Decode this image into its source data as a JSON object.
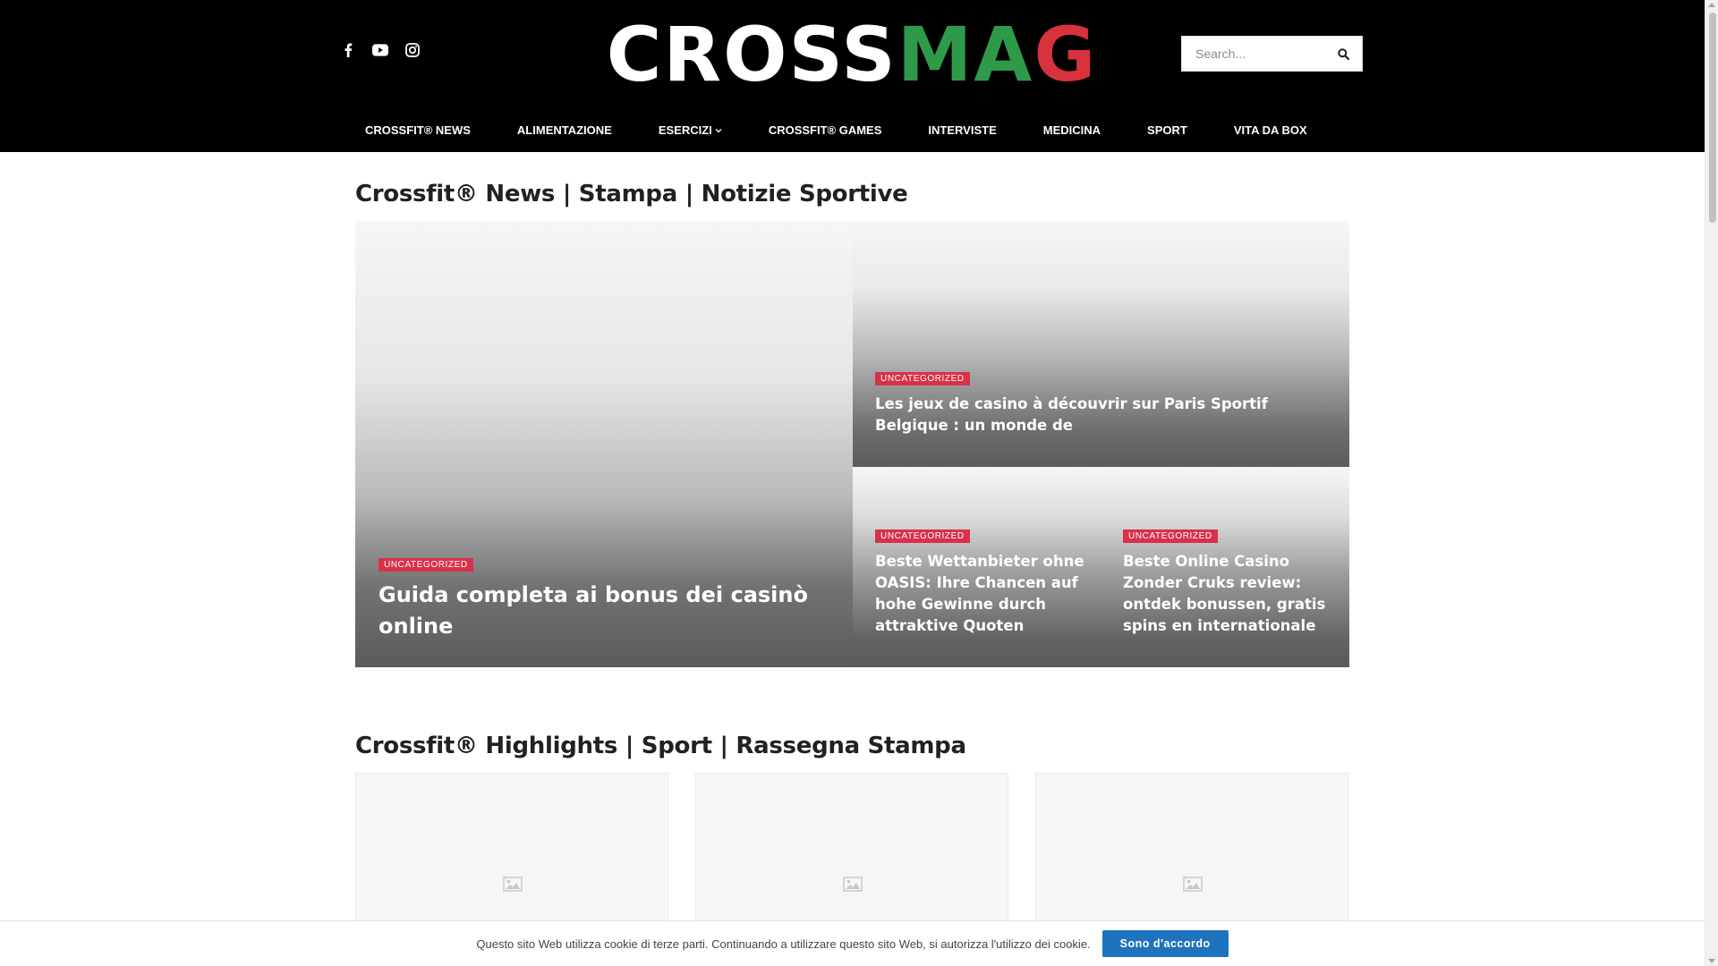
{
  "header": {
    "socials": [
      {
        "icon": "facebook-icon"
      },
      {
        "icon": "youtube-icon"
      },
      {
        "icon": "instagram-icon"
      }
    ],
    "logo": {
      "part_white": "CROSS",
      "part_green": "MA",
      "part_red": "G"
    },
    "search": {
      "placeholder": "Search...",
      "icon": "search-icon"
    }
  },
  "nav": {
    "items": [
      {
        "label": "CROSSFIT® NEWS"
      },
      {
        "label": "ALIMENTAZIONE"
      },
      {
        "label": "ESERCIZI",
        "has_dropdown": true
      },
      {
        "label": "CROSSFIT® GAMES"
      },
      {
        "label": "INTERVISTE"
      },
      {
        "label": "MEDICINA"
      },
      {
        "label": "SPORT"
      },
      {
        "label": "VITA DA BOX"
      }
    ]
  },
  "sections": {
    "news_title": "Crossfit® News | Stampa | Notizie Sportive",
    "highlights_title": "Crossfit® Highlights | Sport | Rassegna Stampa"
  },
  "hero": {
    "main": {
      "category": "UNCATEGORIZED",
      "title": "Guida completa ai bonus dei casinò online"
    },
    "top_right": {
      "category": "UNCATEGORIZED",
      "title": "Les jeux de casino à découvrir sur Paris Sportif Belgique : un monde de"
    },
    "bottom_left": {
      "category": "UNCATEGORIZED",
      "title": "Beste Wettanbieter ohne OASIS: Ihre Chancen auf hohe Gewinne durch attraktive Quoten"
    },
    "bottom_right": {
      "category": "UNCATEGORIZED",
      "title": "Beste Online Casino Zonder Cruks review: ontdek bonussen, gratis spins en internationale"
    }
  },
  "cards": [
    {
      "icon": "image-placeholder-icon"
    },
    {
      "icon": "image-placeholder-icon"
    },
    {
      "icon": "image-placeholder-icon"
    }
  ],
  "cookie": {
    "message": "Questo sito Web utilizza cookie di terze parti. Continuando a utilizzare questo sito Web, si autorizza l'utilizzo dei cookie.",
    "button": "Sono d'accordo"
  },
  "colors": {
    "header_bg": "#000000",
    "badge": "#d8314b",
    "cookie_button": "#1e73be",
    "logo_green": "#2e9a49",
    "logo_red": "#d8323c"
  }
}
